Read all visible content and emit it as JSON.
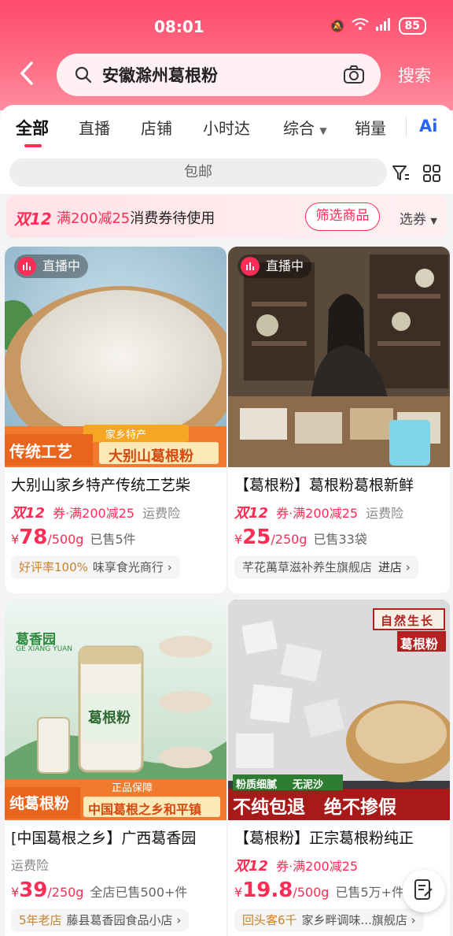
{
  "status": {
    "time": "08:01",
    "battery": "85"
  },
  "search": {
    "query": "安徽滁州葛根粉",
    "button": "搜索"
  },
  "tabs": [
    "全部",
    "直播",
    "店铺",
    "小时达",
    "综合",
    "销量",
    "Ai"
  ],
  "filter": {
    "pill": "包邮"
  },
  "coupon": {
    "tag": "双12",
    "highlight": "满200减25",
    "text": "消费券待使用",
    "button": "筛选商品",
    "select": "选券"
  },
  "products": [
    {
      "live": "直播中",
      "badge_left": "传统工艺",
      "badge_top": "家乡特产",
      "badge_right": "大别山葛根粉",
      "title": "大别山家乡特产传统工艺柴",
      "promo": "双12",
      "promo_coupon": "券·满200减25",
      "promo_ins": "运费险",
      "price_symbol": "¥",
      "price": "78",
      "unit": "/500g",
      "sold": "已售5件",
      "shop_tag": "好评率100%",
      "shop_name": "味享食光商行",
      "shop_action": ""
    },
    {
      "live": "直播中",
      "title": "【葛根粉】葛根粉葛根新鲜",
      "promo": "双12",
      "promo_coupon": "券·满200减25",
      "promo_ins": "运费险",
      "price_symbol": "¥",
      "price": "25",
      "unit": "/250g",
      "sold": "已售33袋",
      "shop_tag": "",
      "shop_name": "芊花萬草滋补养生旗舰店",
      "shop_action": "进店"
    },
    {
      "brand": "葛香园",
      "brand_en": "GE XIANG YUAN",
      "jar_label": "葛根粉",
      "badge_left": "纯葛根粉",
      "badge_top": "正品保障",
      "badge_right": "中国葛根之乡和平镇",
      "title": "[中国葛根之乡】广西葛香园",
      "promo": "",
      "promo_coupon": "",
      "promo_ins": "运费险",
      "price_symbol": "¥",
      "price": "39",
      "unit": "/250g",
      "sold": "全店已售500+件",
      "shop_tag": "5年老店",
      "shop_name": "藤县葛香园食品小店",
      "shop_action": ""
    },
    {
      "top_label_1": "自然生长",
      "top_label_2": "葛根粉",
      "tag_1": "粉质细腻",
      "tag_2": "无泥沙",
      "banner": "不纯包退   绝不掺假",
      "title": "【葛根粉】正宗葛根粉纯正",
      "promo": "双12",
      "promo_coupon": "券·满200减25",
      "promo_ins": "",
      "price_symbol": "¥",
      "price": "19.8",
      "unit": "/500g",
      "sold": "已售5万+件",
      "shop_tag": "回头客6千",
      "shop_name": "家乡畔调味...旗舰店",
      "shop_action": ""
    }
  ],
  "colors": {
    "accent": "#ff2d55",
    "header": "#ff5a78"
  }
}
